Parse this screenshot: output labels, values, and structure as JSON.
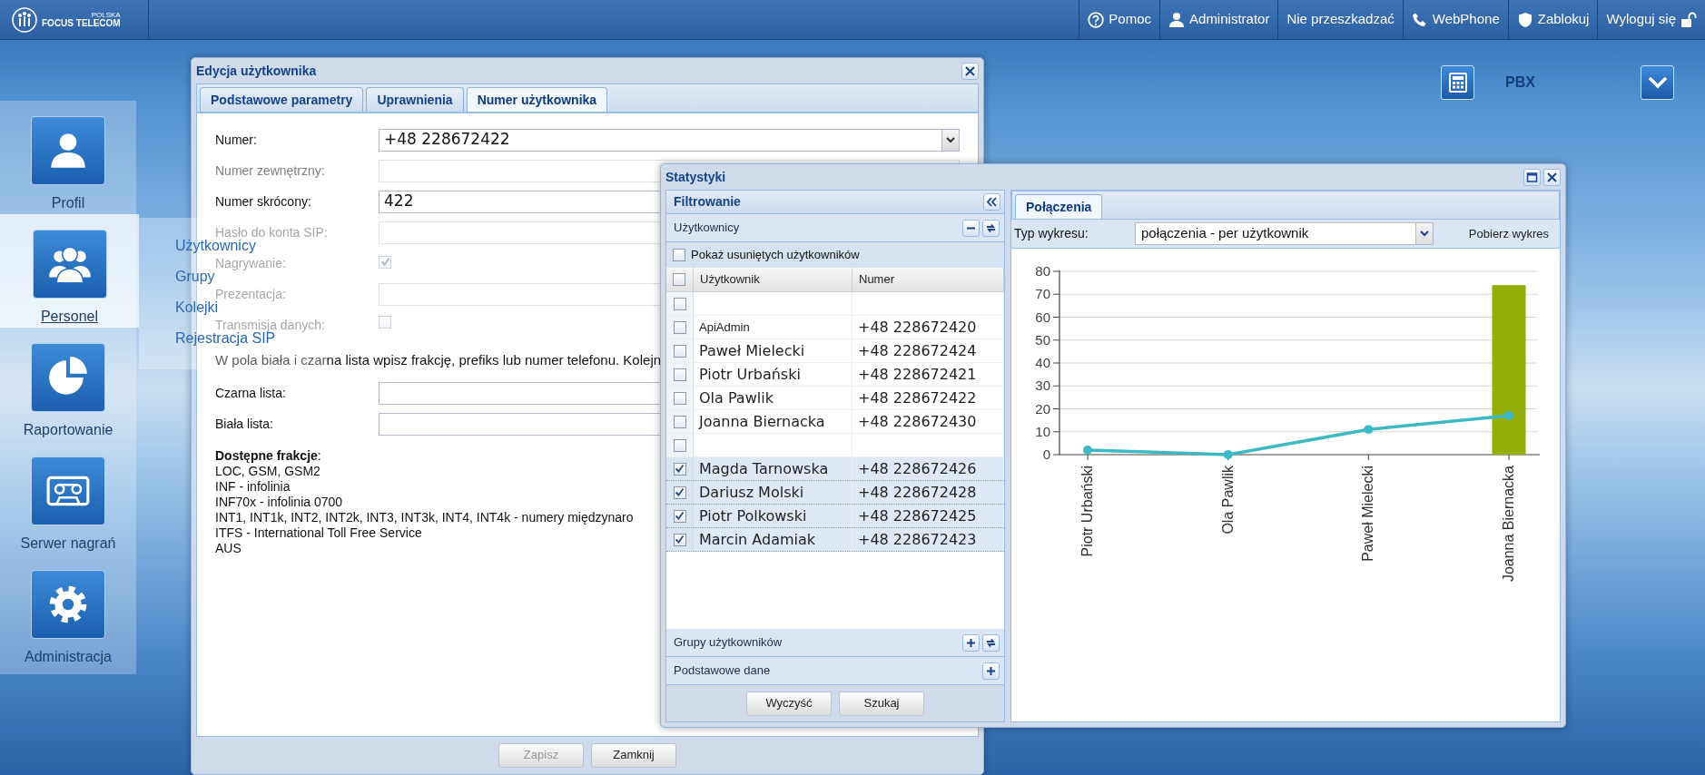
{
  "top_bar": {
    "logo": {
      "name": "FOCUS TELECOM",
      "tag": "POLSKA"
    },
    "items": [
      {
        "kind": "help",
        "label": "Pomoc"
      },
      {
        "kind": "user",
        "label": "Administrator"
      },
      {
        "kind": "plain",
        "label": "Nie przeszkadzać"
      },
      {
        "kind": "phone",
        "label": "WebPhone"
      },
      {
        "kind": "shield",
        "label": "Zablokuj"
      },
      {
        "kind": "logout",
        "label": "Wyloguj się"
      }
    ]
  },
  "module_bar": {
    "label": "PBX"
  },
  "sidebar": {
    "items": [
      {
        "kind": "person",
        "label": "Profil",
        "selected": false
      },
      {
        "kind": "people",
        "label": "Personel",
        "selected": true
      },
      {
        "kind": "pie",
        "label": "Raportowanie",
        "selected": false
      },
      {
        "kind": "cassette",
        "label": "Serwer nagrań",
        "selected": false
      },
      {
        "kind": "gear",
        "label": "Administracja",
        "selected": false
      }
    ],
    "submenu": [
      "Użytkownicy",
      "Grupy",
      "Kolejki",
      "Rejestracja SIP"
    ]
  },
  "user_dialog": {
    "title": "Edycja użytkownika",
    "tabs": [
      {
        "label": "Podstawowe parametry",
        "selected": false
      },
      {
        "label": "Uprawnienia",
        "selected": false
      },
      {
        "label": "Numer użytkownika",
        "selected": true
      }
    ],
    "fields": [
      {
        "label": "Numer:",
        "kind": "select",
        "value": "+48 228672422",
        "disabled": false
      },
      {
        "label": "Numer zewnętrzny:",
        "kind": "text",
        "disabled": true
      },
      {
        "label": "Numer skrócony:",
        "kind": "text",
        "value": "422",
        "disabled": false
      },
      {
        "label": "Hasło do konta SIP:",
        "kind": "text",
        "disabled": true
      },
      {
        "label": "Nagrywanie:",
        "kind": "checkbox",
        "checked": true,
        "disabled": true
      },
      {
        "label": "Prezentacja:",
        "kind": "text",
        "disabled": true
      },
      {
        "label": "Transmisja danych:",
        "kind": "checkbox",
        "checked": false,
        "disabled": true
      }
    ],
    "note": "W pola biała i czarna lista wpisz frakcję, prefiks lub numer telefonu. Kolejn",
    "list_fields": [
      {
        "label": "Czarna lista:"
      },
      {
        "label": "Biała lista:"
      }
    ],
    "fractions": [
      "**Dostępne frakcje**:",
      "LOC, GSM, GSM2",
      "INF - infolinia",
      "INF70x - infolinia 0700",
      "INT1, INT1k, INT2, INT2k, INT3, INT3k, INT4, INT4k - numery międzynaro",
      "ITFS - International Toll Free Service",
      "AUS"
    ],
    "buttons": [
      {
        "label": "Zapisz",
        "disabled": true
      },
      {
        "label": "Zamknij",
        "disabled": false
      }
    ]
  },
  "stats_window": {
    "title": "Statystyki",
    "filter_panel": {
      "title": "Filtrowanie",
      "users": {
        "title": "Użytkownicy",
        "expanded": true,
        "show_deleted": {
          "label": "Pokaż usuniętych użytkowników",
          "checked": false
        },
        "select_all_checked": false,
        "columns": [
          "Użytkownik",
          "Numer"
        ],
        "rows": [
          {
            "checked": false
          },
          {
            "name": "ApiAdmin",
            "number": "+48 228672420",
            "checked": false
          },
          {
            "name": "Paweł Mielecki",
            "number": "+48 228672424",
            "checked": false
          },
          {
            "name": "Piotr Urbański",
            "number": "+48 228672421",
            "checked": false
          },
          {
            "name": "Ola Pawlik",
            "number": "+48 228672422",
            "checked": false
          },
          {
            "name": "Joanna Biernacka",
            "number": "+48 228672430",
            "checked": false
          },
          {
            "checked": false
          },
          {
            "name": "Magda Tarnowska",
            "number": "+48 228672426",
            "checked": true
          },
          {
            "name": "Dariusz Molski",
            "number": "+48 228672428",
            "checked": true
          },
          {
            "name": "Piotr Polkowski",
            "number": "+48 228672425",
            "checked": true
          },
          {
            "name": "Marcin Adamiak",
            "number": "+48 228672423",
            "checked": true
          }
        ]
      },
      "sections": [
        {
          "title": "Grupy użytkowników",
          "expanded": false,
          "refreshable": true
        },
        {
          "title": "Podstawowe dane",
          "expanded": false,
          "refreshable": false
        }
      ],
      "buttons": [
        "Wyczyść",
        "Szukaj"
      ]
    },
    "chart_panel": {
      "tabs": [
        {
          "label": "Połączenia",
          "selected": true
        }
      ],
      "chart_type_label": "Typ wykresu:",
      "chart_type_value": "połączenia - per użytkownik",
      "download_label": "Pobierz wykres",
      "chart_data": {
        "type": "bar",
        "categories": [
          "Piotr Urbański",
          "Ola Pawlik",
          "Paweł Mielecki",
          "Joanna Biernacka"
        ],
        "series": [
          {
            "type": "bar",
            "color": "#94ae0a",
            "values": [
              null,
              null,
              null,
              74
            ]
          },
          {
            "type": "line",
            "color": "#3bb9c4",
            "marker": true,
            "values": [
              2,
              0,
              11,
              17
            ]
          }
        ],
        "grid": true,
        "ylim": [
          0,
          80
        ],
        "yticks": [
          0,
          10,
          20,
          30,
          40,
          50,
          60,
          70,
          80
        ]
      }
    }
  }
}
